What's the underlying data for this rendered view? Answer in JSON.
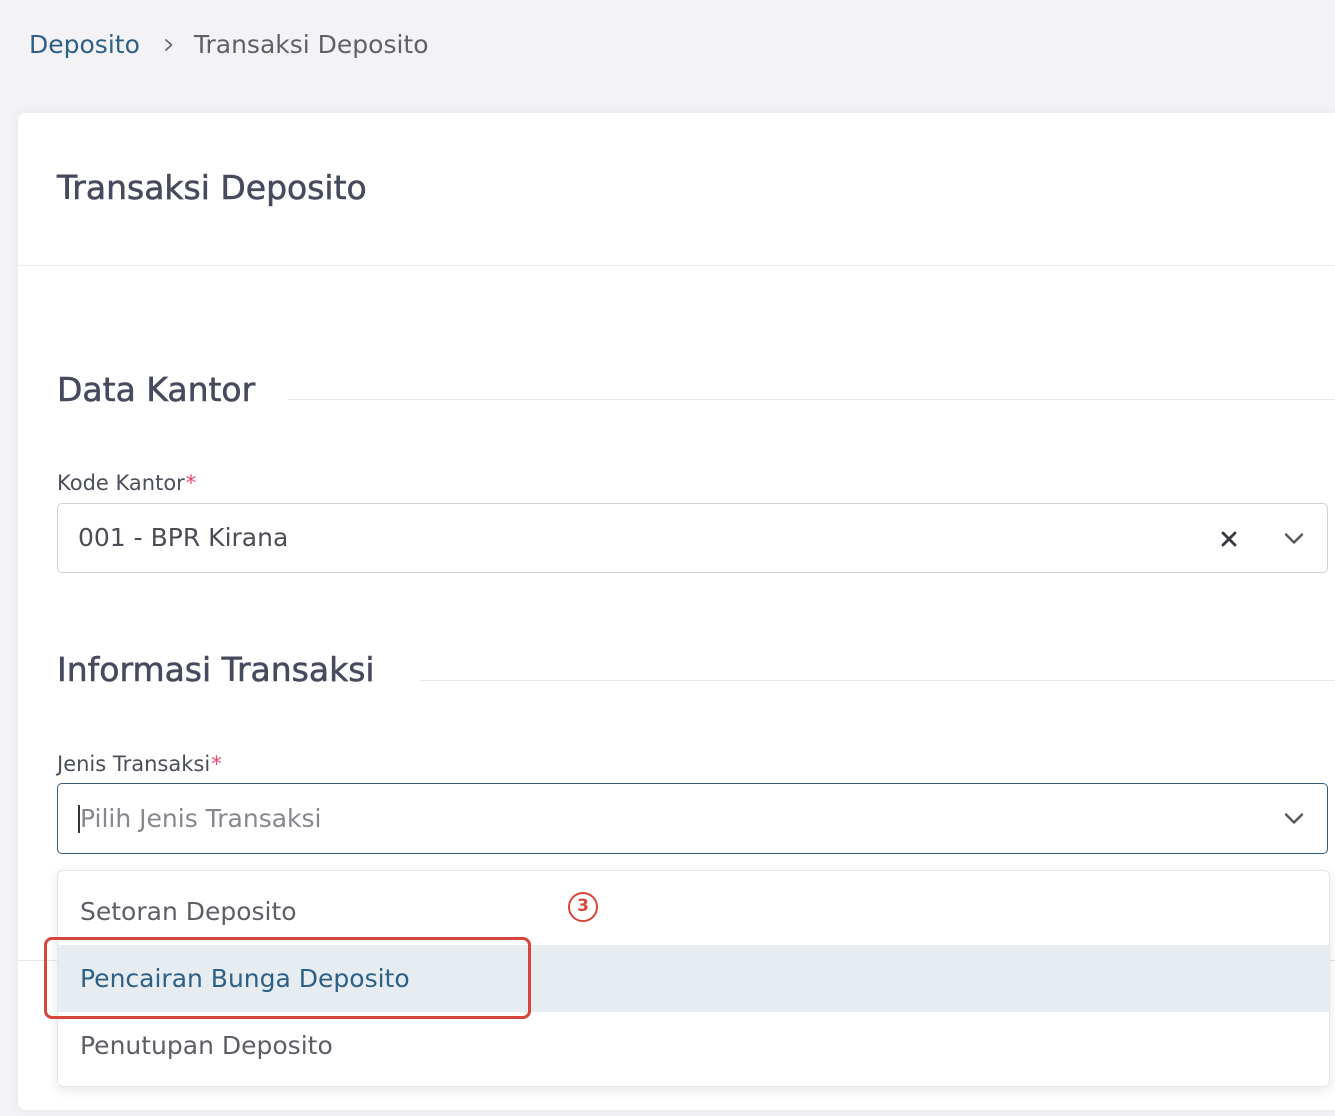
{
  "breadcrumb": {
    "root": "Deposito",
    "current": "Transaksi Deposito"
  },
  "card": {
    "title": "Transaksi Deposito"
  },
  "sections": {
    "office": {
      "heading": "Data Kantor",
      "field": {
        "label": "Kode Kantor",
        "required_mark": "*",
        "value": "001 - BPR Kirana"
      }
    },
    "transaction": {
      "heading": "Informasi Transaksi",
      "field": {
        "label": "Jenis Transaksi",
        "required_mark": "*",
        "value": "",
        "placeholder": "Pilih Jenis Transaksi",
        "focused": true,
        "options": [
          {
            "label": "Setoran Deposito",
            "highlighted": false
          },
          {
            "label": "Pencairan Bunga Deposito",
            "highlighted": true
          },
          {
            "label": "Penutupan Deposito",
            "highlighted": false
          }
        ]
      }
    }
  },
  "annotation": {
    "step_number": "3"
  },
  "icons": {
    "breadcrumb_separator": "chevron-right-icon",
    "clear": "close-icon",
    "toggle": "chevron-down-icon"
  },
  "colors": {
    "page_background": "#f3f3f5",
    "accent": "#2d6087",
    "heading_text": "#474a5d",
    "required_mark": "#f1416c",
    "focus_border": "#345b7e",
    "option_highlight": "#e7ecf0",
    "annotation": "#d6473b"
  }
}
